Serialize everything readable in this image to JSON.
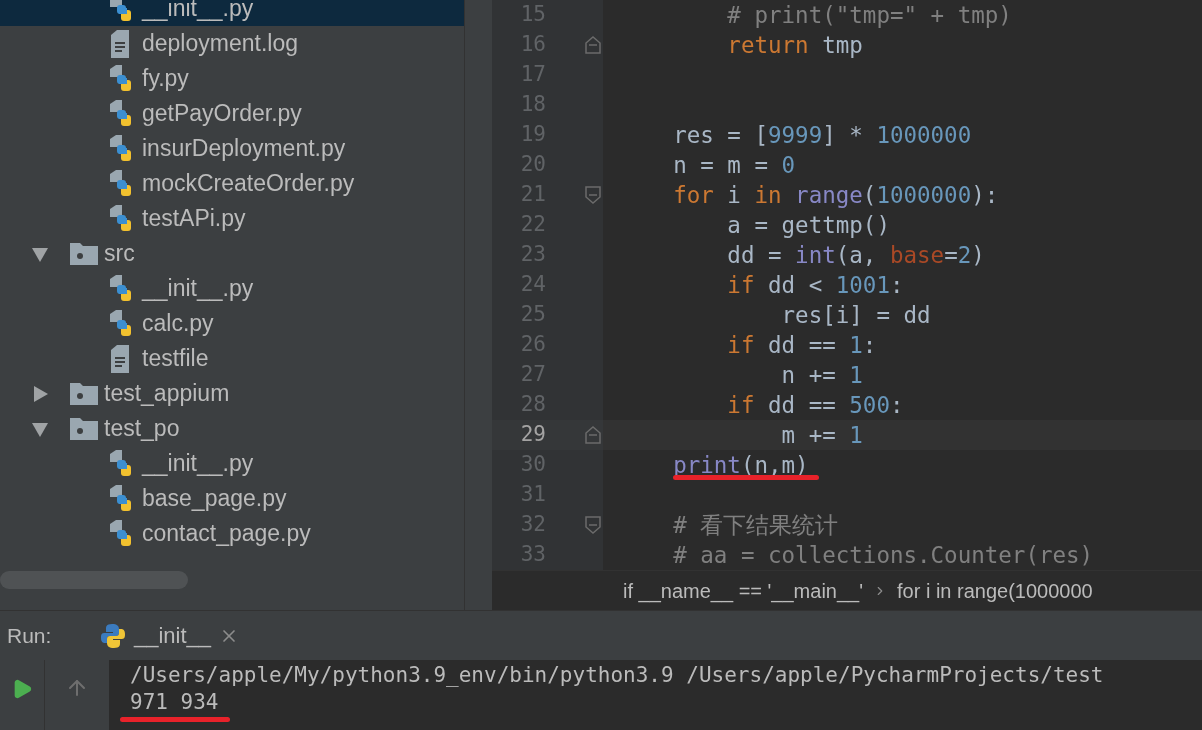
{
  "project_tree": [
    {
      "kind": "group",
      "children": [
        {
          "kind": "python",
          "label": "__init__.py",
          "selected": true
        },
        {
          "kind": "text",
          "label": "deployment.log",
          "selected": false
        },
        {
          "kind": "python",
          "label": "fy.py",
          "selected": false
        },
        {
          "kind": "python",
          "label": "getPayOrder.py",
          "selected": false
        },
        {
          "kind": "python",
          "label": "insurDeployment.py",
          "selected": false
        },
        {
          "kind": "python",
          "label": "mockCreateOrder.py",
          "selected": false
        },
        {
          "kind": "python",
          "label": "testAPi.py",
          "selected": false
        }
      ]
    },
    {
      "kind": "folder",
      "label": "src",
      "expanded": true,
      "selected": false,
      "children": [
        {
          "kind": "python",
          "label": "__init__.py",
          "selected": false
        },
        {
          "kind": "python",
          "label": "calc.py",
          "selected": false
        },
        {
          "kind": "text",
          "label": "testfile",
          "selected": false
        }
      ]
    },
    {
      "kind": "folder",
      "label": "test_appium",
      "expanded": false,
      "selected": false
    },
    {
      "kind": "folder",
      "label": "test_po",
      "expanded": true,
      "selected": false,
      "children": [
        {
          "kind": "python",
          "label": "__init__.py",
          "selected": false
        },
        {
          "kind": "python",
          "label": "base_page.py",
          "selected": false
        },
        {
          "kind": "python",
          "label": "contact_page.py",
          "selected": false
        }
      ]
    }
  ],
  "editor": {
    "lines": [
      {
        "number": "15",
        "current": false,
        "fold_start": false,
        "fold_end": false,
        "underlined": false,
        "tokens": [
          {
            "kind": "comment",
            "text": "        # print(\"tmp=\" + tmp)"
          }
        ]
      },
      {
        "number": "16",
        "current": false,
        "fold_start": false,
        "fold_end": true,
        "underlined": false,
        "tokens": [
          {
            "kind": "keyword",
            "text": "        return"
          },
          {
            "kind": "plain",
            "text": " tmp"
          }
        ]
      },
      {
        "number": "17",
        "current": false,
        "fold_start": false,
        "fold_end": false,
        "underlined": false
      },
      {
        "number": "18",
        "current": false,
        "fold_start": false,
        "fold_end": false,
        "underlined": false
      },
      {
        "number": "19",
        "current": false,
        "fold_start": false,
        "fold_end": false,
        "underlined": false,
        "tokens": [
          {
            "kind": "plain",
            "text": "    res = ["
          },
          {
            "kind": "number",
            "text": "9999"
          },
          {
            "kind": "plain",
            "text": "] * "
          },
          {
            "kind": "number",
            "text": "1000000"
          }
        ]
      },
      {
        "number": "20",
        "current": false,
        "fold_start": false,
        "fold_end": false,
        "underlined": false,
        "tokens": [
          {
            "kind": "plain",
            "text": "    n = m = "
          },
          {
            "kind": "number",
            "text": "0"
          }
        ]
      },
      {
        "number": "21",
        "current": false,
        "fold_start": true,
        "fold_end": false,
        "underlined": false,
        "tokens": [
          {
            "kind": "keyword",
            "text": "    for"
          },
          {
            "kind": "plain",
            "text": " i "
          },
          {
            "kind": "keyword",
            "text": "in"
          },
          {
            "kind": "builtin",
            "text": " range"
          },
          {
            "kind": "plain",
            "text": "("
          },
          {
            "kind": "number",
            "text": "1000000"
          },
          {
            "kind": "plain",
            "text": "):"
          }
        ]
      },
      {
        "number": "22",
        "current": false,
        "fold_start": false,
        "fold_end": false,
        "underlined": false,
        "tokens": [
          {
            "kind": "plain",
            "text": "        a = gettmp()"
          }
        ]
      },
      {
        "number": "23",
        "current": false,
        "fold_start": false,
        "fold_end": false,
        "underlined": false,
        "tokens": [
          {
            "kind": "plain",
            "text": "        dd = "
          },
          {
            "kind": "builtin",
            "text": "int"
          },
          {
            "kind": "plain",
            "text": "(a, "
          },
          {
            "kind": "param",
            "text": "base"
          },
          {
            "kind": "plain",
            "text": "="
          },
          {
            "kind": "number",
            "text": "2"
          },
          {
            "kind": "plain",
            "text": ")"
          }
        ]
      },
      {
        "number": "24",
        "current": false,
        "fold_start": false,
        "fold_end": false,
        "underlined": false,
        "tokens": [
          {
            "kind": "keyword",
            "text": "        if"
          },
          {
            "kind": "plain",
            "text": " dd < "
          },
          {
            "kind": "number",
            "text": "1001"
          },
          {
            "kind": "plain",
            "text": ":"
          }
        ]
      },
      {
        "number": "25",
        "current": false,
        "fold_start": false,
        "fold_end": false,
        "underlined": false,
        "tokens": [
          {
            "kind": "plain",
            "text": "            res[i] = dd"
          }
        ]
      },
      {
        "number": "26",
        "current": false,
        "fold_start": false,
        "fold_end": false,
        "underlined": false,
        "tokens": [
          {
            "kind": "keyword",
            "text": "        if"
          },
          {
            "kind": "plain",
            "text": " dd == "
          },
          {
            "kind": "number",
            "text": "1"
          },
          {
            "kind": "plain",
            "text": ":"
          }
        ]
      },
      {
        "number": "27",
        "current": false,
        "fold_start": false,
        "fold_end": false,
        "underlined": false,
        "tokens": [
          {
            "kind": "plain",
            "text": "            n += "
          },
          {
            "kind": "number",
            "text": "1"
          }
        ]
      },
      {
        "number": "28",
        "current": false,
        "fold_start": false,
        "fold_end": false,
        "underlined": false,
        "tokens": [
          {
            "kind": "keyword",
            "text": "        if"
          },
          {
            "kind": "plain",
            "text": " dd == "
          },
          {
            "kind": "number",
            "text": "500"
          },
          {
            "kind": "plain",
            "text": ":"
          }
        ]
      },
      {
        "number": "29",
        "current": true,
        "fold_start": false,
        "fold_end": true,
        "underlined": false,
        "tokens": [
          {
            "kind": "plain",
            "text": "            m += "
          },
          {
            "kind": "number",
            "text": "1"
          }
        ]
      },
      {
        "number": "30",
        "current": false,
        "fold_start": false,
        "fold_end": false,
        "underlined": true,
        "tokens": [
          {
            "kind": "builtin",
            "text": "    print"
          },
          {
            "kind": "plain",
            "text": "(n,m)"
          }
        ]
      },
      {
        "number": "31",
        "current": false,
        "fold_start": false,
        "fold_end": false,
        "underlined": false
      },
      {
        "number": "32",
        "current": false,
        "fold_start": true,
        "fold_end": false,
        "underlined": false,
        "tokens": [
          {
            "kind": "comment",
            "text": "    # 看下结果统计"
          }
        ]
      },
      {
        "number": "33",
        "current": false,
        "fold_start": false,
        "fold_end": false,
        "underlined": false,
        "tokens": [
          {
            "kind": "comment",
            "text": "    # aa = collections.Counter(res)"
          }
        ]
      }
    ],
    "breadcrumbs": [
      "if __name__ == '__main__'",
      "for i in range(1000000"
    ]
  },
  "run_panel": {
    "label": "Run:",
    "tab": "__init__",
    "output": [
      {
        "text": "/Users/apple/My/python3.9_env/bin/python3.9 /Users/apple/PycharmProjects/test",
        "underlined": false
      },
      {
        "text": "971 934",
        "underlined": true
      }
    ]
  }
}
